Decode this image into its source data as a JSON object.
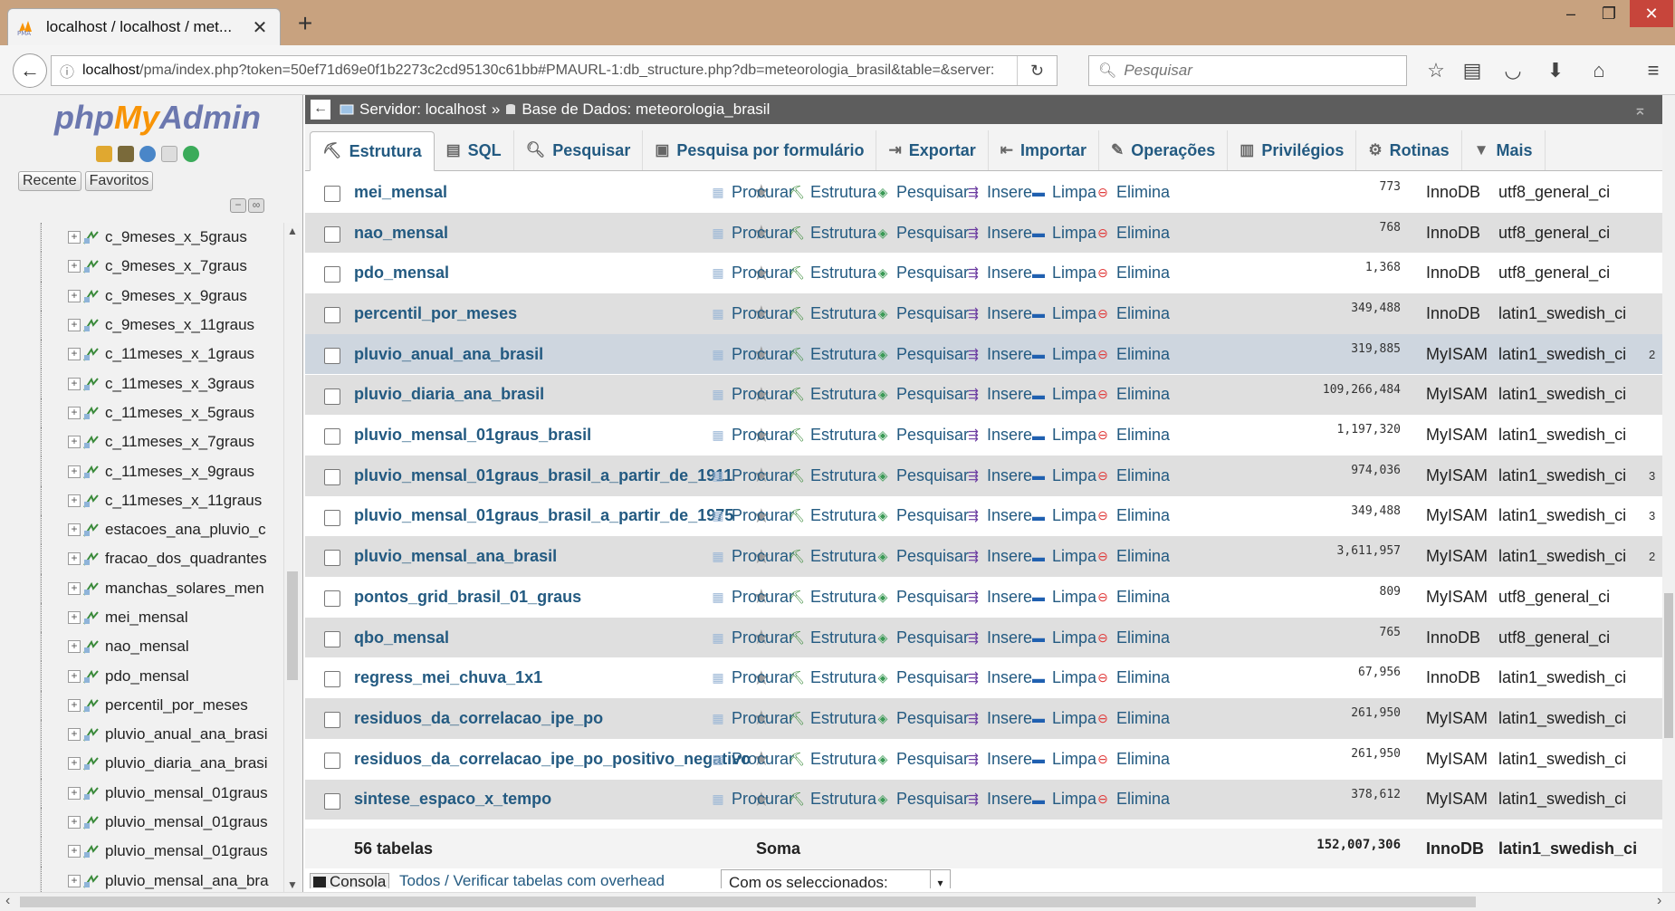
{
  "browser": {
    "tab_title": "localhost / localhost / met...",
    "url_host": "localhost",
    "url_rest": "/pma/index.php?token=50ef71d69e0f1b2273c2cd95130c61bb#PMAURL-1:db_structure.php?db=meteorologia_brasil&table=&server:",
    "search_placeholder": "Pesquisar"
  },
  "sidebar": {
    "logo_php": "php",
    "logo_my": "My",
    "logo_admin": "Admin",
    "recent_label": "Recente",
    "favorites_label": "Favoritos",
    "tree_items": [
      "c_9meses_x_5graus",
      "c_9meses_x_7graus",
      "c_9meses_x_9graus",
      "c_9meses_x_11graus",
      "c_11meses_x_1graus",
      "c_11meses_x_3graus",
      "c_11meses_x_5graus",
      "c_11meses_x_7graus",
      "c_11meses_x_9graus",
      "c_11meses_x_11graus",
      "estacoes_ana_pluvio_c",
      "fracao_dos_quadrantes",
      "manchas_solares_men",
      "mei_mensal",
      "nao_mensal",
      "pdo_mensal",
      "percentil_por_meses",
      "pluvio_anual_ana_brasi",
      "pluvio_diaria_ana_brasi",
      "pluvio_mensal_01graus",
      "pluvio_mensal_01graus",
      "pluvio_mensal_01graus",
      "pluvio_mensal_ana_bra"
    ]
  },
  "breadcrumb": {
    "server": "Servidor: localhost",
    "sep": "»",
    "database": "Base de Dados: meteorologia_brasil"
  },
  "menu_tabs": [
    {
      "label": "Estrutura",
      "icon": "structure-icon"
    },
    {
      "label": "SQL",
      "icon": "sql-icon"
    },
    {
      "label": "Pesquisar",
      "icon": "search-icon"
    },
    {
      "label": "Pesquisa por formulário",
      "icon": "query-icon"
    },
    {
      "label": "Exportar",
      "icon": "export-icon"
    },
    {
      "label": "Importar",
      "icon": "import-icon"
    },
    {
      "label": "Operações",
      "icon": "wrench-icon"
    },
    {
      "label": "Privilégios",
      "icon": "privileges-icon"
    },
    {
      "label": "Rotinas",
      "icon": "routines-icon"
    },
    {
      "label": "Mais",
      "icon": "triangle-down-icon"
    }
  ],
  "actions": {
    "browse": "Procurar",
    "structure": "Estrutura",
    "search": "Pesquisar",
    "insert": "Insere",
    "empty": "Limpa",
    "drop": "Elimina"
  },
  "tables": [
    {
      "name": "mei_mensal",
      "rows": "773",
      "engine": "InnoDB",
      "collation": "utf8_general_ci",
      "extra": ""
    },
    {
      "name": "nao_mensal",
      "rows": "768",
      "engine": "InnoDB",
      "collation": "utf8_general_ci",
      "extra": ""
    },
    {
      "name": "pdo_mensal",
      "rows": "1,368",
      "engine": "InnoDB",
      "collation": "utf8_general_ci",
      "extra": ""
    },
    {
      "name": "percentil_por_meses",
      "rows": "349,488",
      "engine": "InnoDB",
      "collation": "latin1_swedish_ci",
      "extra": ""
    },
    {
      "name": "pluvio_anual_ana_brasil",
      "rows": "319,885",
      "engine": "MyISAM",
      "collation": "latin1_swedish_ci",
      "extra": "2"
    },
    {
      "name": "pluvio_diaria_ana_brasil",
      "rows": "109,266,484",
      "engine": "MyISAM",
      "collation": "latin1_swedish_ci",
      "extra": ""
    },
    {
      "name": "pluvio_mensal_01graus_brasil",
      "rows": "1,197,320",
      "engine": "MyISAM",
      "collation": "latin1_swedish_ci",
      "extra": ""
    },
    {
      "name": "pluvio_mensal_01graus_brasil_a_partir_de_1911",
      "rows": "974,036",
      "engine": "MyISAM",
      "collation": "latin1_swedish_ci",
      "extra": "3"
    },
    {
      "name": "pluvio_mensal_01graus_brasil_a_partir_de_1975",
      "rows": "349,488",
      "engine": "MyISAM",
      "collation": "latin1_swedish_ci",
      "extra": "3"
    },
    {
      "name": "pluvio_mensal_ana_brasil",
      "rows": "3,611,957",
      "engine": "MyISAM",
      "collation": "latin1_swedish_ci",
      "extra": "2"
    },
    {
      "name": "pontos_grid_brasil_01_graus",
      "rows": "809",
      "engine": "MyISAM",
      "collation": "utf8_general_ci",
      "extra": ""
    },
    {
      "name": "qbo_mensal",
      "rows": "765",
      "engine": "InnoDB",
      "collation": "utf8_general_ci",
      "extra": ""
    },
    {
      "name": "regress_mei_chuva_1x1",
      "rows": "67,956",
      "engine": "InnoDB",
      "collation": "latin1_swedish_ci",
      "extra": ""
    },
    {
      "name": "residuos_da_correlacao_ipe_po",
      "rows": "261,950",
      "engine": "MyISAM",
      "collation": "latin1_swedish_ci",
      "extra": ""
    },
    {
      "name": "residuos_da_correlacao_ipe_po_positivo_negativo",
      "rows": "261,950",
      "engine": "MyISAM",
      "collation": "latin1_swedish_ci",
      "extra": ""
    },
    {
      "name": "sintese_espaco_x_tempo",
      "rows": "378,612",
      "engine": "MyISAM",
      "collation": "latin1_swedish_ci",
      "extra": ""
    }
  ],
  "summary": {
    "count": "56 tabelas",
    "label": "Soma",
    "rows": "152,007,306",
    "engine": "InnoDB",
    "collation": "latin1_swedish_ci"
  },
  "footer": {
    "console": "Consola",
    "check_links": "Todos / Verificar tabelas com overhead",
    "with_selected": "Com os seleccionados:"
  }
}
